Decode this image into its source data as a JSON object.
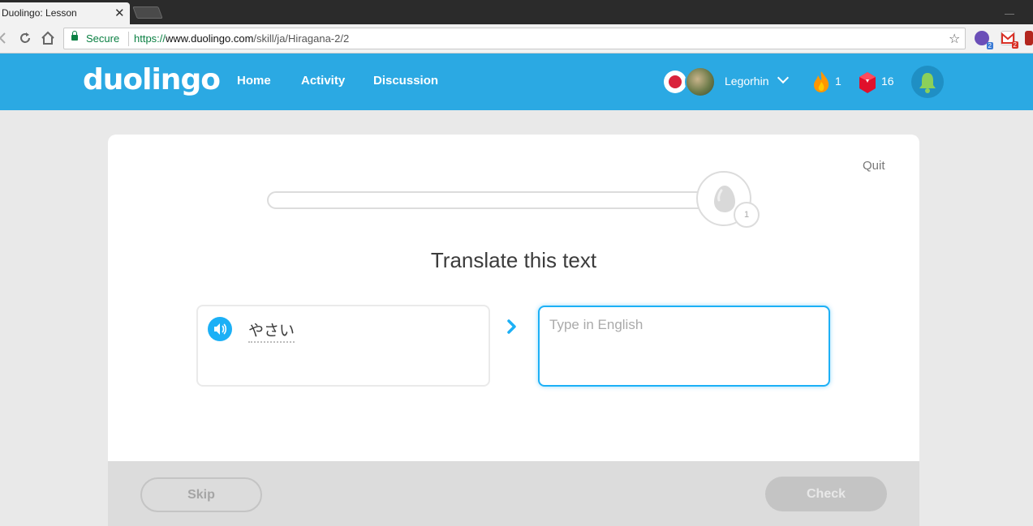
{
  "browser": {
    "tab_title": "Duolingo: Lesson",
    "tab_close": "✕",
    "secure_label": "Secure",
    "url_scheme": "https://",
    "url_host": "www.duolingo.com",
    "url_path": "/skill/ja/Hiragana-2/2",
    "extension_badges": [
      "2",
      "2"
    ]
  },
  "header": {
    "logo": "duolingo",
    "nav": [
      "Home",
      "Activity",
      "Discussion"
    ],
    "username": "Legorhin",
    "streak": "1",
    "gems": "16",
    "brand_color": "#2ba9e3"
  },
  "lesson": {
    "quit_label": "Quit",
    "progress_fraction": 0.0,
    "egg_count": "1",
    "prompt": "Translate this text",
    "source_text": "やさい",
    "answer_placeholder": "Type in English",
    "answer_value": "",
    "skip_label": "Skip",
    "check_label": "Check"
  }
}
